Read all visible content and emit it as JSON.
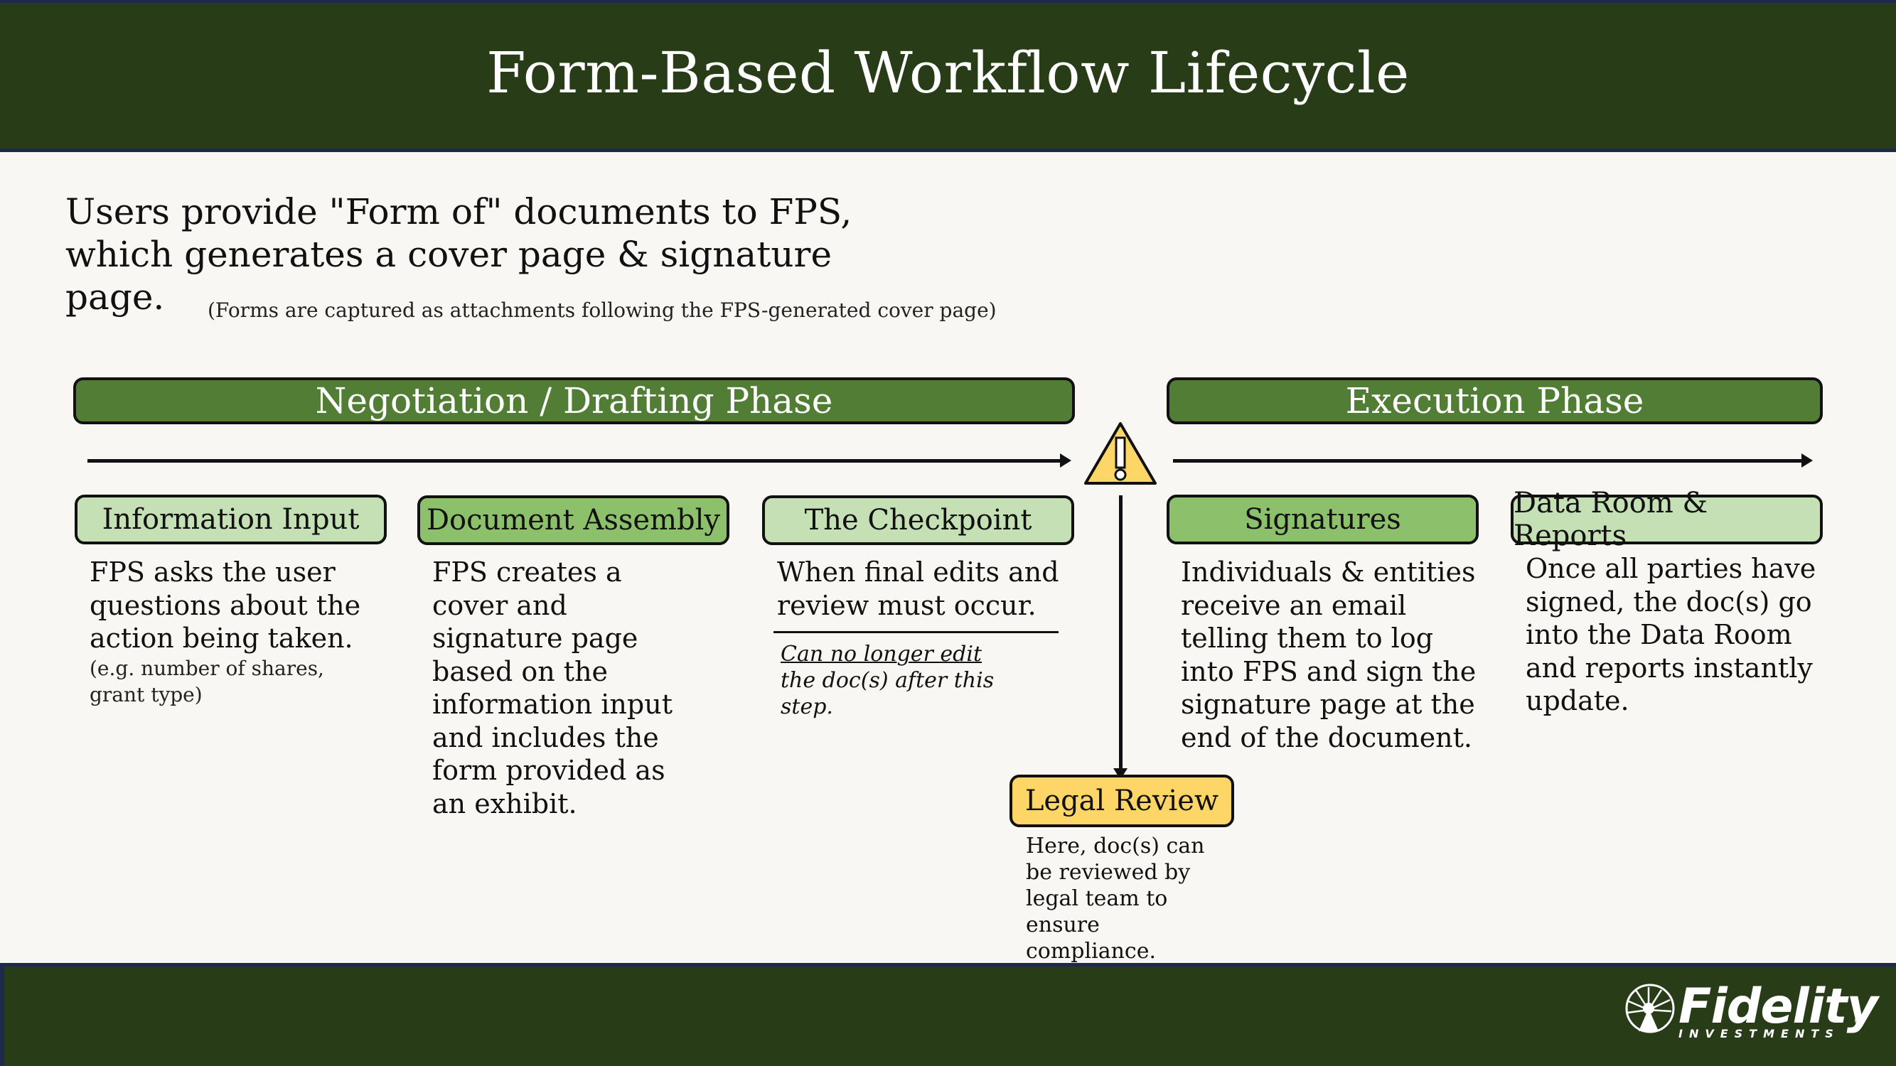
{
  "header": {
    "title": "Form-Based Workflow Lifecycle"
  },
  "intro": {
    "text": "Users provide \"Form of\" documents to FPS, which generates a cover page & signature page.",
    "note": "(Forms are captured as attachments following the FPS-generated cover page)"
  },
  "phases": {
    "negotiation": "Negotiation / Drafting Phase",
    "execution": "Execution Phase"
  },
  "checkpoint_icon": "warning-icon",
  "steps": [
    {
      "label": "Information Input",
      "description": "FPS asks the user questions about the action being taken.",
      "note": "(e.g. number of shares, grant type)"
    },
    {
      "label": "Document Assembly",
      "description": "FPS creates a cover and signature page based on the information input and includes the form provided as an exhibit."
    },
    {
      "label": "The Checkpoint",
      "description": "When final edits and review must occur.",
      "note_underlined": "Can no longer edit ",
      "note_rest": "the doc(s) after this step."
    },
    {
      "label": "Signatures",
      "description": "Individuals & entities receive an email telling them to log into FPS and sign the signature page at the end of the document."
    },
    {
      "label": "Data Room & Reports",
      "description": "Once all parties have signed, the doc(s) go into the Data Room and reports instantly update."
    }
  ],
  "legal_review": {
    "label": "Legal Review",
    "description": "Here, doc(s) can be reviewed by legal team to ensure compliance."
  },
  "footer": {
    "logo_name": "Fidelity",
    "logo_sub": "INVESTMENTS",
    "logo_mark": "®"
  },
  "colors": {
    "header_bg": "#283c18",
    "phase_bg": "#527d34",
    "step_light": "#c5e0b4",
    "step_mid": "#8dc06a",
    "warning_yellow": "#fdd667",
    "page_bg": "#f9f7f4"
  }
}
